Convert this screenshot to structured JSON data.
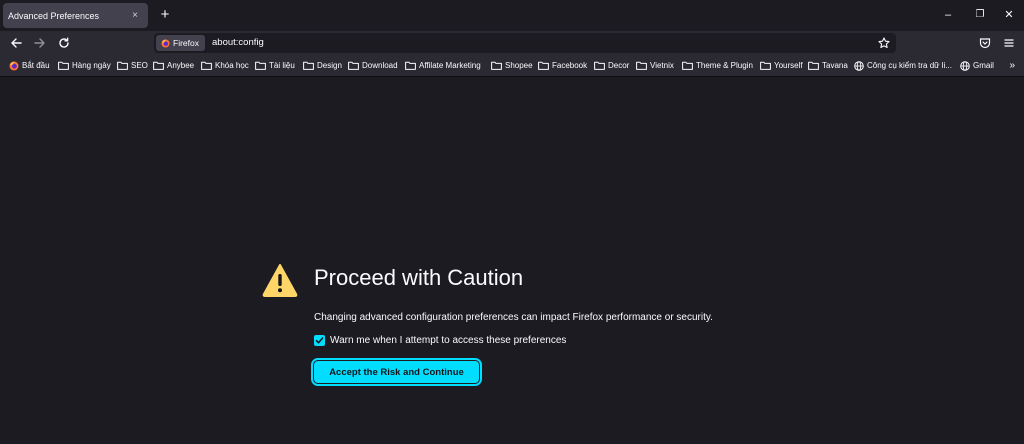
{
  "tab": {
    "title": "Advanced Preferences",
    "close": "×"
  },
  "newtab": {
    "label": "+"
  },
  "window_controls": {
    "minimize": "–",
    "restore": "❐",
    "close": "✕"
  },
  "urlbar": {
    "identity_label": "Firefox",
    "url": "about:config"
  },
  "bookmarks": [
    {
      "label": "Bắt đầu",
      "icon": "firefox-icon"
    },
    {
      "label": "Hàng ngày",
      "icon": "folder-icon"
    },
    {
      "label": "SEO",
      "icon": "folder-icon"
    },
    {
      "label": "Anybee",
      "icon": "folder-icon"
    },
    {
      "label": "Khóa học",
      "icon": "folder-icon"
    },
    {
      "label": "Tài liệu",
      "icon": "folder-icon"
    },
    {
      "label": "Design",
      "icon": "folder-icon"
    },
    {
      "label": "Download",
      "icon": "folder-icon"
    },
    {
      "label": "Affilate Marketing",
      "icon": "folder-icon"
    },
    {
      "label": "Shopee",
      "icon": "folder-icon"
    },
    {
      "label": "Facebook",
      "icon": "folder-icon"
    },
    {
      "label": "Decor",
      "icon": "folder-icon"
    },
    {
      "label": "Vietnix",
      "icon": "folder-icon"
    },
    {
      "label": "Theme & Plugin",
      "icon": "folder-icon"
    },
    {
      "label": "Yourself",
      "icon": "folder-icon"
    },
    {
      "label": "Tavana",
      "icon": "folder-icon"
    },
    {
      "label": "Công cụ kiểm tra dữ li...",
      "icon": "globe-icon"
    },
    {
      "label": "Gmail",
      "icon": "globe-icon"
    }
  ],
  "bookmarks_more": "»",
  "content": {
    "heading": "Proceed with Caution",
    "description": "Changing advanced configuration preferences can impact Firefox performance or security.",
    "checkbox_label": "Warn me when I attempt to access these preferences",
    "checkbox_checked": true,
    "accept_button": "Accept the Risk and Continue"
  },
  "colors": {
    "background": "#1c1b22",
    "toolbar": "#2b2a33",
    "accent": "#00ddff",
    "warning": "#ffd567"
  }
}
